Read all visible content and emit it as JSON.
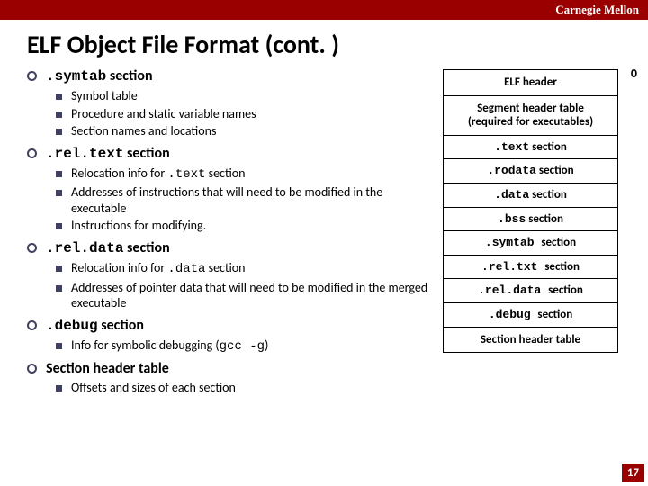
{
  "header": {
    "brand": "Carnegie Mellon"
  },
  "title": "ELF Object File Format (cont. )",
  "bullets": [
    {
      "label_mono": ".symtab",
      "label_rest": " section",
      "sub": [
        {
          "text": "Symbol table"
        },
        {
          "text": "Procedure and static variable names"
        },
        {
          "text": "Section names and locations"
        }
      ]
    },
    {
      "label_mono": ".rel.text",
      "label_rest": " section",
      "sub": [
        {
          "pre": "Relocation info for ",
          "mono": ".text",
          "post": " section"
        },
        {
          "text": "Addresses of instructions that will need to be modified in the executable"
        },
        {
          "text": "Instructions for modifying."
        }
      ]
    },
    {
      "label_mono": ".rel.data",
      "label_rest": " section",
      "sub": [
        {
          "pre": "Relocation info for ",
          "mono": ".data",
          "post": " section"
        },
        {
          "text": "Addresses of pointer data that will need to be modified in the merged executable"
        }
      ]
    },
    {
      "label_mono": ".debug",
      "label_rest": " section",
      "sub": [
        {
          "pre": "Info for symbolic debugging (",
          "mono": "gcc -g",
          "post": ")"
        }
      ]
    },
    {
      "label_plain": "Section header table",
      "sub": [
        {
          "text": "Offsets and sizes of each section"
        }
      ]
    }
  ],
  "diagram": {
    "zero": "0",
    "cells": [
      {
        "bold": "ELF header"
      },
      {
        "bold": "Segment header table\n(required for executables)"
      },
      {
        "mono": ".text",
        "rest": " section"
      },
      {
        "mono": ".rodata",
        "rest": " section"
      },
      {
        "mono": ".data",
        "rest": " section"
      },
      {
        "mono": ".bss",
        "rest": " section"
      },
      {
        "mono": ".symtab ",
        "rest": " section"
      },
      {
        "mono": ".rel.txt ",
        "rest": " section"
      },
      {
        "mono": ".rel.data ",
        "rest": " section"
      },
      {
        "mono": ".debug ",
        "rest": " section"
      },
      {
        "bold": "Section header table"
      }
    ]
  },
  "pagenum": "17"
}
